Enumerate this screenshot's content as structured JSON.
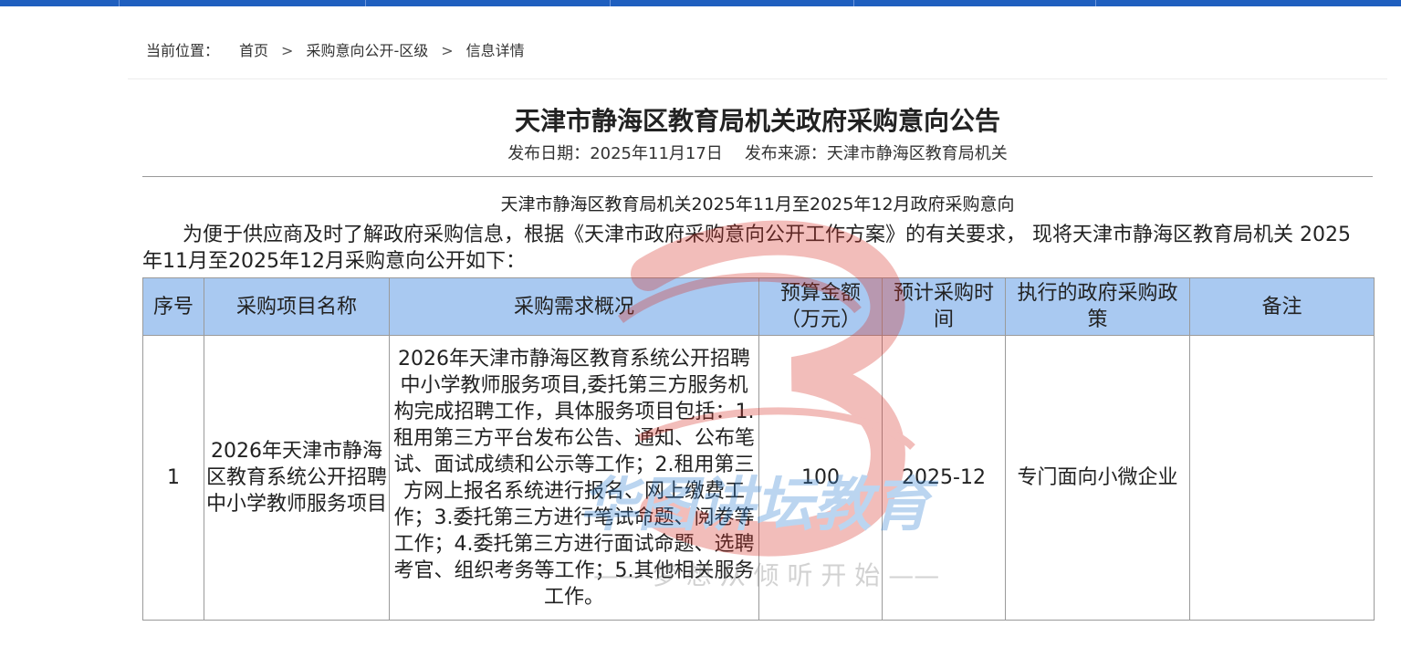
{
  "breadcrumb": {
    "prefix": "当前位置：",
    "items": [
      "首页",
      "采购意向公开-区级",
      "信息详情"
    ],
    "separator": ">"
  },
  "article": {
    "title": "天津市静海区教育局机关政府采购意向公告",
    "publish_date_label": "发布日期：",
    "publish_date": "2025年11月17日",
    "source_label": "发布来源：",
    "source": "天津市静海区教育局机关",
    "subtitle": "天津市静海区教育局机关2025年11月至2025年12月政府采购意向",
    "intro": "为便于供应商及时了解政府采购信息，根据《天津市政府采购意向公开工作方案》的有关要求， 现将天津市静海区教育局机关 2025年11月至2025年12月采购意向公开如下："
  },
  "table": {
    "headers": {
      "index": "序号",
      "project_name": "采购项目名称",
      "requirements": "采购需求概况",
      "budget": "预算金额（万元）",
      "time": "预计采购时间",
      "policy": "执行的政府采购政策",
      "remarks": "备注"
    },
    "rows": [
      {
        "index": "1",
        "project_name": "2026年天津市静海区教育系统公开招聘中小学教师服务项目",
        "requirements": "2026年天津市静海区教育系统公开招聘中小学教师服务项目,委托第三方服务机构完成招聘工作，具体服务项目包括：1.租用第三方平台发布公告、通知、公布笔试、面试成绩和公示等工作；2.租用第三方网上报名系统进行报名、网上缴费工作；3.委托第三方进行笔试命题、阅卷等工作；4.委托第三方进行面试命题、选聘考官、组织考务等工作；5.其他相关服务工作。",
        "budget": "100",
        "time": "2025-12",
        "policy": "专门面向小微企业",
        "remarks": ""
      }
    ]
  },
  "watermark": {
    "brand": "华图讲坛教育",
    "slogan": "—— 梦 想 从 倾 听 开 始 ——"
  },
  "colors": {
    "top_bar": "#1f5fbf",
    "table_header_bg": "#a9c9f1",
    "watermark_red": "#d9342b",
    "watermark_blue": "#2f7fd1"
  }
}
